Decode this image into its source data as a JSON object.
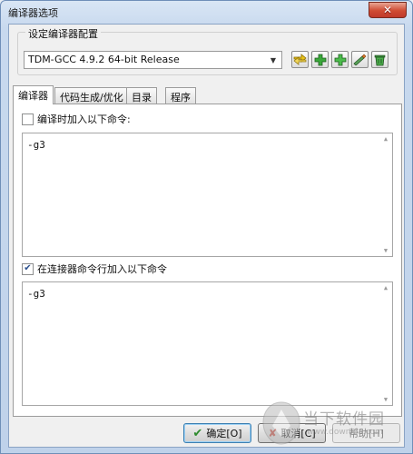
{
  "window": {
    "title": "编译器选项",
    "close_label": "✕"
  },
  "config": {
    "group_label": "设定编译器配置",
    "selected": "TDM-GCC 4.9.2 64-bit Release",
    "tool_icons": [
      "switch-config-icon",
      "add-config-icon",
      "add-copy-icon",
      "rename-config-icon",
      "delete-config-icon"
    ]
  },
  "tabs": [
    {
      "label": "编译器",
      "active": true
    },
    {
      "label": "代码生成/优化",
      "active": false
    },
    {
      "label": "目录",
      "active": false
    },
    {
      "label": "程序",
      "active": false
    }
  ],
  "compiler": {
    "compile_cmd_label": "编译时加入以下命令:",
    "compile_cmd_checked": false,
    "compile_cmd_value": "-g3",
    "linker_cmd_label": "在连接器命令行加入以下命令",
    "linker_cmd_checked": true,
    "linker_cmd_value": "-g3"
  },
  "buttons": {
    "ok": "确定[O]",
    "cancel": "取消[C]",
    "help": "帮助[H]"
  },
  "watermark": {
    "text": "当下软件园",
    "sub": "www.downxia.com"
  },
  "colors": {
    "accent_green": "#2e8b2e",
    "close_red": "#cf4b32"
  }
}
